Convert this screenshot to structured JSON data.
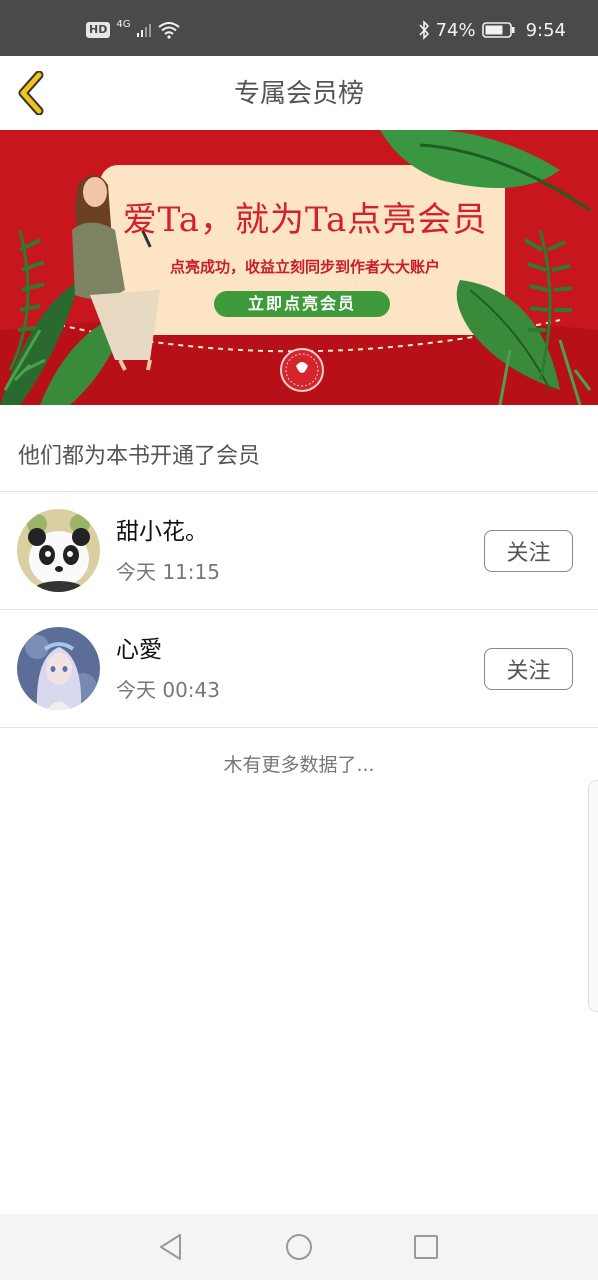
{
  "status_bar": {
    "network_badge": "HD",
    "network_type": "4G",
    "battery_percent": "74%",
    "time": "9:54",
    "icons": [
      "signal-icon",
      "wifi-icon",
      "bluetooth-icon",
      "battery-icon"
    ]
  },
  "header": {
    "title": "专属会员榜",
    "back_icon": "chevron-left-icon",
    "accent_color": "#f2c318"
  },
  "banner": {
    "headline": "爱Ta，就为Ta点亮会员",
    "subline": "点亮成功，收益立刻同步到作者大大账户",
    "cta_label": "立即点亮会员",
    "colors": {
      "background": "#c8161e",
      "card": "#fde4c4",
      "cta": "#3f9a3c"
    }
  },
  "section": {
    "title": "他们都为本书开通了会员"
  },
  "members": [
    {
      "name": "甜小花。",
      "time": "今天 11:15",
      "follow_label": "关注",
      "avatar": "panda-avatar"
    },
    {
      "name": "心愛",
      "time": "今天 00:43",
      "follow_label": "关注",
      "avatar": "doll-avatar"
    }
  ],
  "footer": {
    "no_more_text": "木有更多数据了..."
  },
  "nav_bar": {
    "buttons": [
      "back-triangle-icon",
      "home-circle-icon",
      "recents-square-icon"
    ]
  }
}
